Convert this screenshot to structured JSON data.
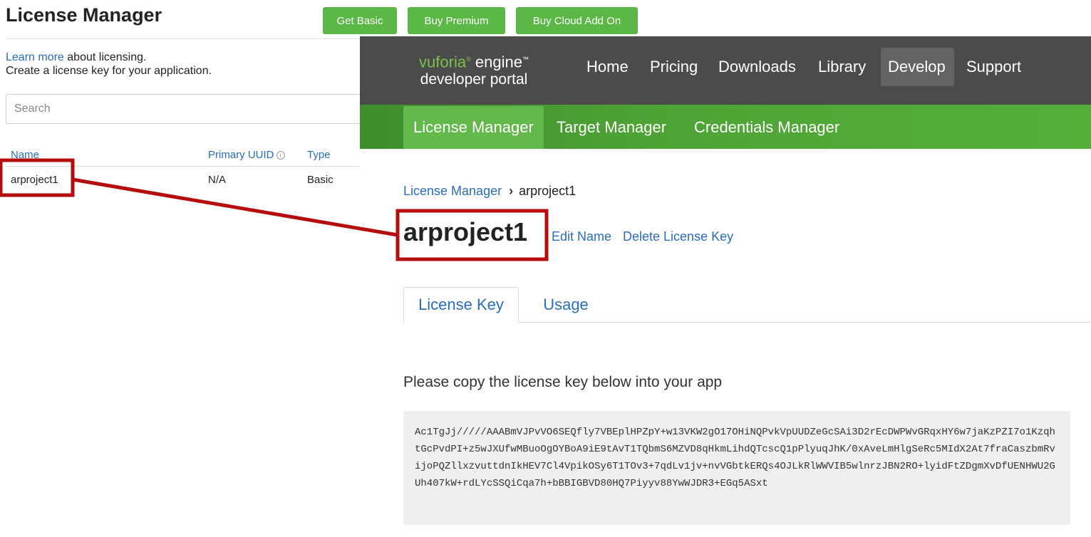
{
  "left_panel": {
    "title": "License Manager",
    "intro_link": "Learn more",
    "intro_rest": "about licensing.",
    "intro_line2": "Create a license key for your application.",
    "search_placeholder": "Search",
    "table": {
      "headers": {
        "name": "Name",
        "primary_uuid": "Primary UUID",
        "type": "Type"
      },
      "rows": [
        {
          "name": "arproject1",
          "primary_uuid": "N/A",
          "type": "Basic"
        }
      ]
    }
  },
  "top_buttons": {
    "get_basic": "Get Basic",
    "buy_premium": "Buy Premium",
    "buy_cloud_add_on": "Buy Cloud Add On",
    "color": "#5bb846"
  },
  "portal": {
    "logo": {
      "brand": "vuforia",
      "product": "engine",
      "registered_mark": "®",
      "trademark": "™",
      "subtitle": "developer portal"
    },
    "nav": [
      "Home",
      "Pricing",
      "Downloads",
      "Library",
      "Develop",
      "Support"
    ],
    "nav_active": "Develop",
    "sub_nav": [
      "License Manager",
      "Target Manager",
      "Credentials Manager"
    ],
    "sub_nav_active": "License Manager",
    "breadcrumb": {
      "parent": "License Manager",
      "separator": "›",
      "current": "arproject1"
    },
    "title": "arproject1",
    "actions": {
      "edit": "Edit Name",
      "delete": "Delete License Key"
    },
    "tabs": [
      "License Key",
      "Usage"
    ],
    "tab_active": "License Key",
    "copy_label": "Please copy the license key below into your app",
    "license_key": "Ac1TgJj/////AAABmVJPvVO6SEQfly7VBEplHPZpY+w13VKW2gO17OHiNQPvkVpUUDZeGcSAi3D2rEcDWPWvGRqxHY6w7jaKzPZI7o1KzqhtGcPvdPI+z5wJXUfwMBuoOgOYBoA9iE9tAvT1TQbmS6MZVD8qHkmLihdQTcscQ1pPlyuqJhK/0xAveLmHlgSeRc5MIdX2At7fraCaszbmRvijoPQZllxzvuttdnIkHEV7Cl4VpikOSy6T1TOv3+7qdLv1jv+nvVGbtkERQs4OJLkRlWWVIB5wlnrzJBN2RO+lyidFtZDgmXvDfUENHWU2GUh407kW+rdLYcSSQiCqa7h+bBBIGBVD80HQ7Piyyv88YwWJDR3+EGq5ASxt"
  },
  "colors": {
    "annotation": "#b50d0d",
    "link": "#2a6ebb",
    "nav_bg": "#4b4b4b",
    "subnav_bg": "#54ae3a"
  }
}
